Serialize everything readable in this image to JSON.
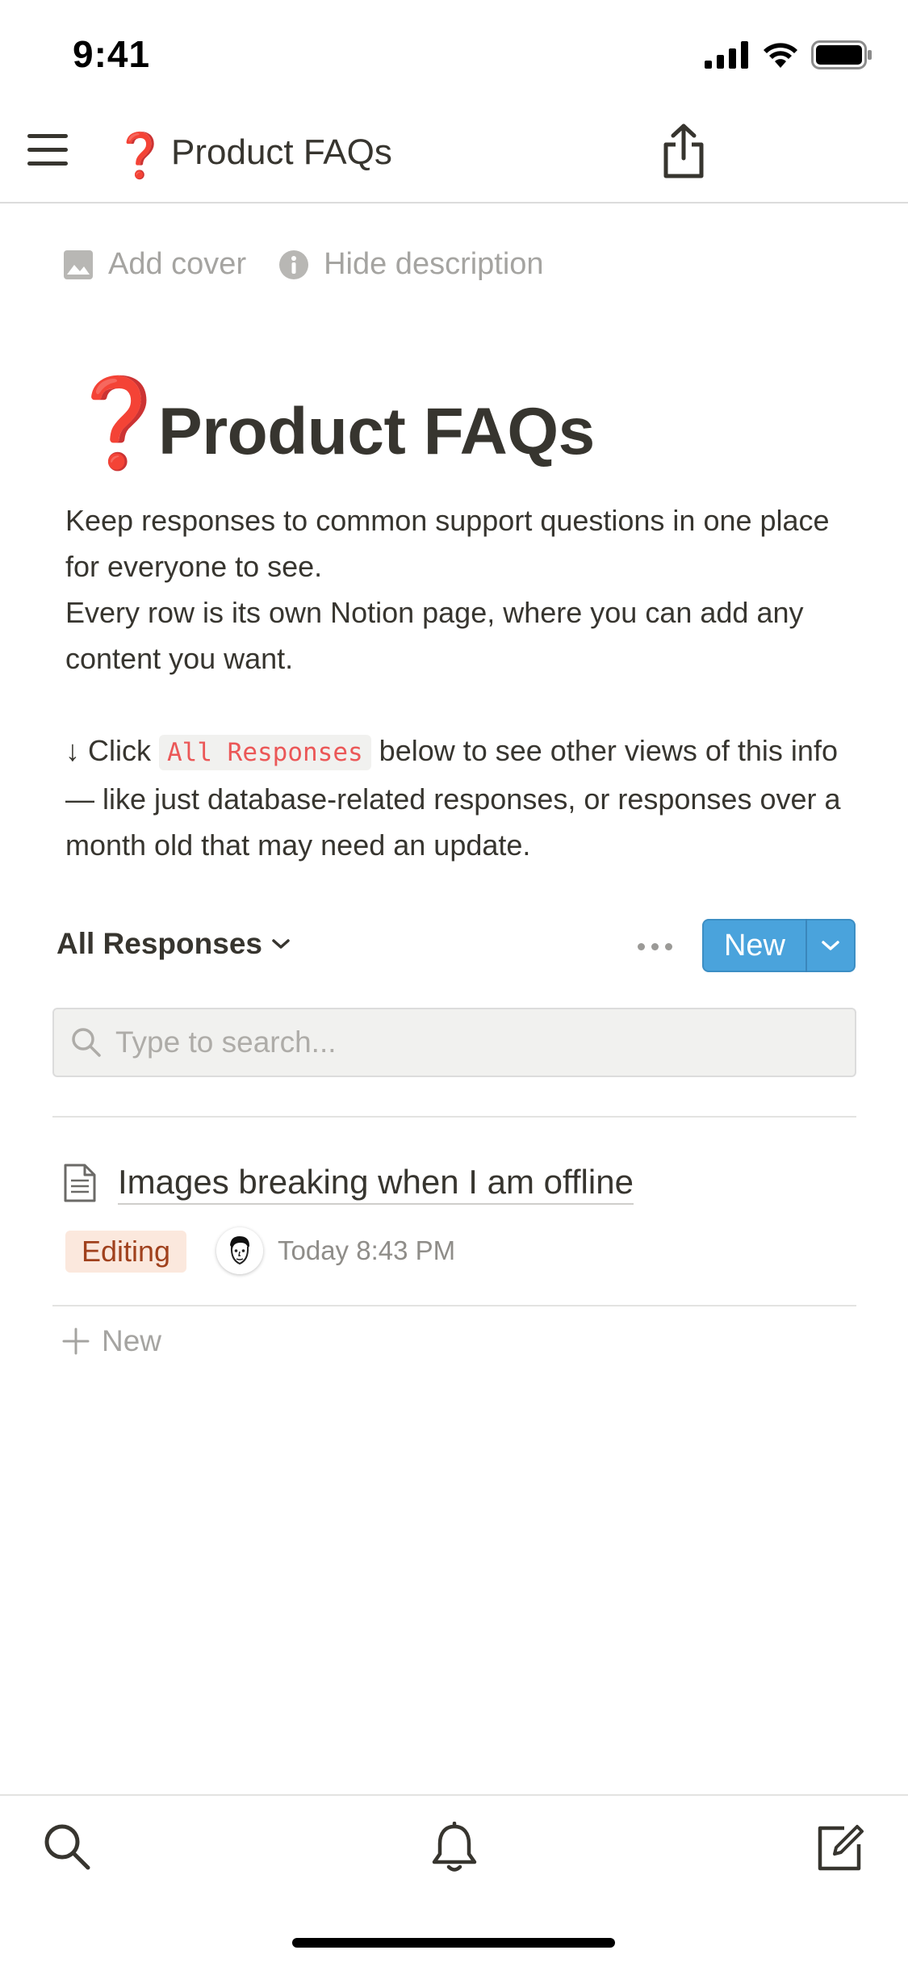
{
  "status_bar": {
    "time": "9:41"
  },
  "nav": {
    "emoji": "❓",
    "title": "Product FAQs"
  },
  "page_meta": {
    "add_cover": "Add cover",
    "hide_description": "Hide description"
  },
  "page": {
    "emoji": "❓",
    "title": "Product FAQs",
    "description": {
      "line1": "Keep responses to common support questions in one place for everyone to see.",
      "line2": "Every row is its own Notion page, where you can add any content you want.",
      "click_prefix": "↓ Click",
      "click_code": "All Responses",
      "click_suffix": "below to see other views of this info — like just database-related responses, or responses over a month old that may need an update."
    }
  },
  "database": {
    "view_name": "All Responses",
    "new_button": "New",
    "search": {
      "placeholder": "Type to search...",
      "value": ""
    },
    "rows": [
      {
        "title": "Images breaking when I am offline",
        "tag": "Editing",
        "time": "Today 8:43 PM"
      }
    ],
    "add_new": "New"
  },
  "colors": {
    "accent": "#4aa3dc",
    "emoji_red": "#d12b2b",
    "tag_bg": "#fbe8dd",
    "tag_text": "#a0411d",
    "code_text": "#eb5757"
  },
  "bottom_nav": {
    "icons": [
      "search-icon",
      "bell-icon",
      "compose-icon"
    ]
  }
}
